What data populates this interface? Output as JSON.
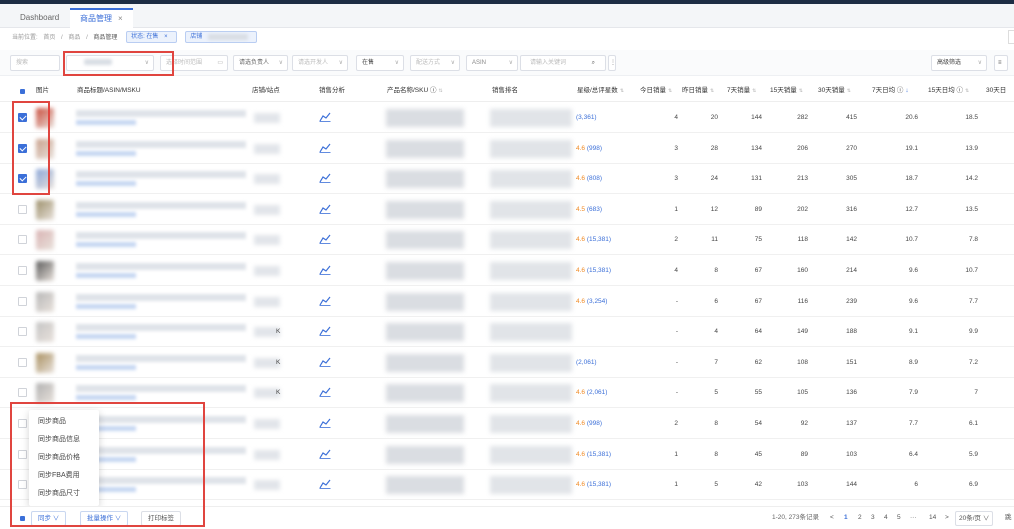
{
  "tabs": [
    {
      "label": "Dashboard"
    },
    {
      "label": "商品管理",
      "close": "×"
    }
  ],
  "breadcrumb": {
    "items": [
      "当前位置:",
      "首页",
      "/",
      "商品",
      "/",
      "商品管理"
    ],
    "tags": [
      {
        "label": "状态: 在售",
        "close": "×"
      },
      {
        "label": "店铺"
      }
    ]
  },
  "filters": {
    "search_placeholder": "搜索",
    "date_placeholder": "选择时间范围",
    "owner_placeholder": "请选负责人",
    "dev_placeholder": "请选开发人",
    "status_value": "在售",
    "fulfill_placeholder": "配送方式",
    "field_value": "ASIN",
    "keyword_placeholder": "请输入关键词",
    "advanced_label": "高级筛选",
    "more_label": "≡"
  },
  "table": {
    "headers": {
      "image": "图片",
      "title": "商品标题/ASIN/MSKU",
      "shop": "店铺/站点",
      "analysis": "销售分析",
      "product": "产品名称/SKU ⓘ",
      "category": "销售排名",
      "rating": "星级/总评星数",
      "today": "今日销量",
      "yesterday": "昨日销量",
      "d7": "7天销量",
      "d15": "15天销量",
      "d30": "30天销量",
      "avg7": "7天日均 ⓘ",
      "avg15": "15天日均 ⓘ",
      "avg30": "30天日"
    },
    "rows": [
      {
        "checked": true,
        "thumb": "#c94b3a",
        "shop_suffix": "",
        "rating": "(3,361)",
        "star": "",
        "today": "4",
        "yesterday": "20",
        "d7": "144",
        "d15": "282",
        "d30": "415",
        "avg7": "20.6",
        "avg15": "18.5"
      },
      {
        "checked": true,
        "thumb": "#c9a08b",
        "shop_suffix": "",
        "rating": "(998)",
        "star": "4.6",
        "today": "3",
        "yesterday": "28",
        "d7": "134",
        "d15": "206",
        "d30": "270",
        "avg7": "19.1",
        "avg15": "13.9"
      },
      {
        "checked": true,
        "thumb": "#8aa6d8",
        "shop_suffix": "",
        "rating": "(808)",
        "star": "4.6",
        "today": "3",
        "yesterday": "24",
        "d7": "131",
        "d15": "213",
        "d30": "305",
        "avg7": "18.7",
        "avg15": "14.2"
      },
      {
        "checked": false,
        "thumb": "#9c8f6a",
        "shop_suffix": "",
        "rating": "(683)",
        "star": "4.5",
        "today": "1",
        "yesterday": "12",
        "d7": "89",
        "d15": "202",
        "d30": "316",
        "avg7": "12.7",
        "avg15": "13.5"
      },
      {
        "checked": false,
        "thumb": "#d9b3b3",
        "shop_suffix": "",
        "rating": "(15,381)",
        "star": "4.6",
        "today": "2",
        "yesterday": "11",
        "d7": "75",
        "d15": "118",
        "d30": "142",
        "avg7": "10.7",
        "avg15": "7.8"
      },
      {
        "checked": false,
        "thumb": "#5a5a5a",
        "shop_suffix": "",
        "rating": "(15,381)",
        "star": "4.6",
        "today": "4",
        "yesterday": "8",
        "d7": "67",
        "d15": "160",
        "d30": "214",
        "avg7": "9.6",
        "avg15": "10.7"
      },
      {
        "checked": false,
        "thumb": "#b7b7b7",
        "shop_suffix": "",
        "rating": "(3,254)",
        "star": "4.6",
        "today": "-",
        "yesterday": "6",
        "d7": "67",
        "d15": "116",
        "d30": "239",
        "avg7": "9.6",
        "avg15": "7.7"
      },
      {
        "checked": false,
        "thumb": "#c4c4c4",
        "shop_suffix": "K",
        "rating": "",
        "star": "",
        "today": "-",
        "yesterday": "4",
        "d7": "64",
        "d15": "149",
        "d30": "188",
        "avg7": "9.1",
        "avg15": "9.9"
      },
      {
        "checked": false,
        "thumb": "#a99060",
        "shop_suffix": "K",
        "rating": "(2,061)",
        "star": "",
        "today": "-",
        "yesterday": "7",
        "d7": "62",
        "d15": "108",
        "d30": "151",
        "avg7": "8.9",
        "avg15": "7.2"
      },
      {
        "checked": false,
        "thumb": "#b0b0b0",
        "shop_suffix": "K",
        "rating": "(2,061)",
        "star": "4.6",
        "today": "-",
        "yesterday": "5",
        "d7": "55",
        "d15": "105",
        "d30": "136",
        "avg7": "7.9",
        "avg15": "7"
      },
      {
        "checked": false,
        "thumb": "#c8b89a",
        "shop_suffix": "",
        "rating": "(998)",
        "star": "4.6",
        "today": "2",
        "yesterday": "8",
        "d7": "54",
        "d15": "92",
        "d30": "137",
        "avg7": "7.7",
        "avg15": "6.1"
      },
      {
        "checked": false,
        "thumb": "#9e9e9e",
        "shop_suffix": "",
        "rating": "(15,381)",
        "star": "4.6",
        "today": "1",
        "yesterday": "8",
        "d7": "45",
        "d15": "89",
        "d30": "103",
        "avg7": "6.4",
        "avg15": "5.9"
      },
      {
        "checked": false,
        "thumb": "#bdbdbd",
        "shop_suffix": "",
        "rating": "(15,381)",
        "star": "4.6",
        "today": "1",
        "yesterday": "5",
        "d7": "42",
        "d15": "103",
        "d30": "144",
        "avg7": "6",
        "avg15": "6.9"
      }
    ]
  },
  "sync_menu": {
    "items": [
      "同步商品",
      "同步商品信息",
      "同步商品价格",
      "同步FBA费用",
      "同步商品尺寸"
    ]
  },
  "bottom": {
    "sync_label": "同步 ∨",
    "batch_label": "批量操作 ∨",
    "print_label": "打印标签",
    "total": "1-20, 273条记录",
    "prev": "<",
    "pages": [
      "1",
      "2",
      "3",
      "4",
      "5",
      "···",
      "14"
    ],
    "next": ">",
    "page_size": "20条/页 ∨",
    "goto": "跳"
  },
  "colors": {
    "accent": "#3b6fd8",
    "highlight": "#e0453f",
    "star": "#f08a24"
  }
}
